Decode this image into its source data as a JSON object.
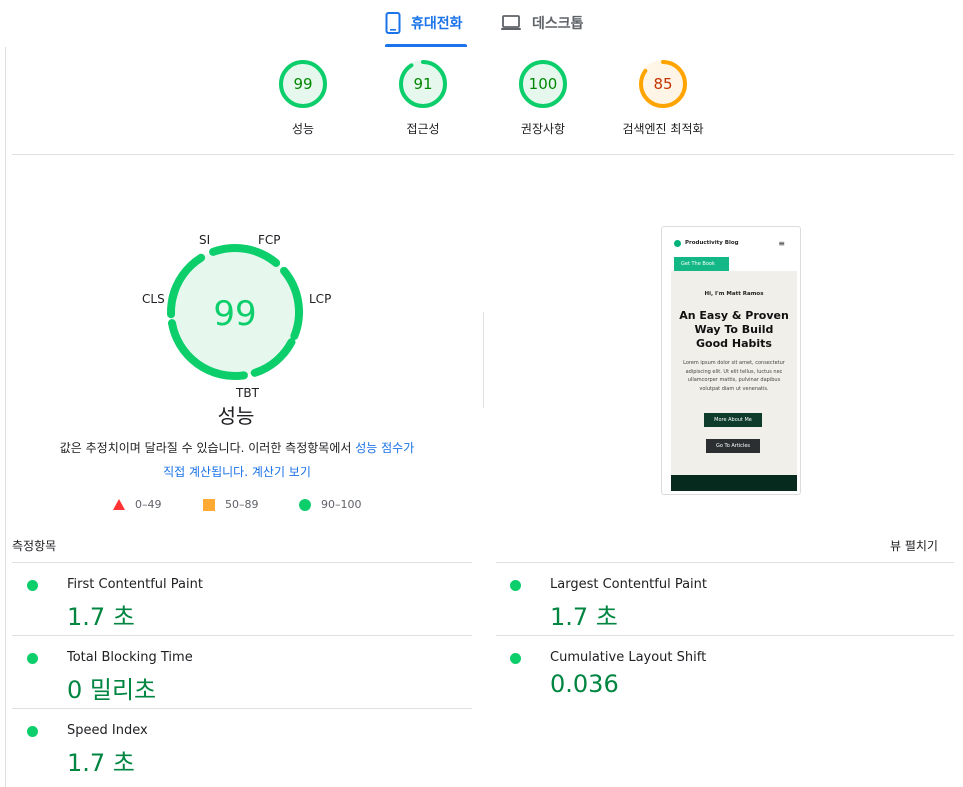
{
  "tabs": {
    "mobile": "휴대전화",
    "desktop": "데스크톱"
  },
  "categories": [
    {
      "score": "99",
      "label": "성능",
      "status": "pass"
    },
    {
      "score": "91",
      "label": "접근성",
      "status": "pass"
    },
    {
      "score": "100",
      "label": "권장사항",
      "status": "pass"
    },
    {
      "score": "85",
      "label": "검색엔진 최적화",
      "status": "average"
    }
  ],
  "performance": {
    "score": "99",
    "title": "성능",
    "gauge_labels": {
      "si": "SI",
      "fcp": "FCP",
      "lcp": "LCP",
      "cls": "CLS",
      "tbt": "TBT"
    },
    "desc_text": "값은 추정치이며 달라질 수 있습니다. 이러한 측정항목에서 ",
    "desc_link1": "성능 점수가",
    "desc_link2": "직접 계산됩니다.",
    "desc_link3": "계산기 보기"
  },
  "legend": [
    {
      "range": "0–49",
      "color": "#ff3333"
    },
    {
      "range": "50–89",
      "color": "#ffaa33"
    },
    {
      "range": "90–100",
      "color": "#0cce6b"
    }
  ],
  "metrics_header": {
    "title": "측정항목",
    "expand": "뷰 펼치기"
  },
  "metrics": [
    {
      "name": "First Contentful Paint",
      "value": "1.7 초"
    },
    {
      "name": "Largest Contentful Paint",
      "value": "1.7 초"
    },
    {
      "name": "Total Blocking Time",
      "value": "0 밀리초"
    },
    {
      "name": "Cumulative Layout Shift",
      "value": "0.036"
    },
    {
      "name": "Speed Index",
      "value": "1.7 초"
    }
  ],
  "screenshot": {
    "brand": "Productivity Blog",
    "cta_tab": "Get The Book",
    "greeting": "Hi, I'm Matt Ramos",
    "headline": "An Easy & Proven Way To Build Good Habits",
    "body": "Lorem ipsum dolor sit amet, consectetur adipiscing elit. Ut elit tellus, luctus nec ullamcorper mattis, pulvinar dapibus volutpat diam ut venenatis.",
    "btn1": "More About Me",
    "btn2": "Go To Articles"
  },
  "colors": {
    "pass": "#0cce6b",
    "pass_text": "#008800",
    "average": "#ffa400",
    "average_text": "#c33300",
    "link": "#1a73e8",
    "metric_value": "#018642"
  }
}
